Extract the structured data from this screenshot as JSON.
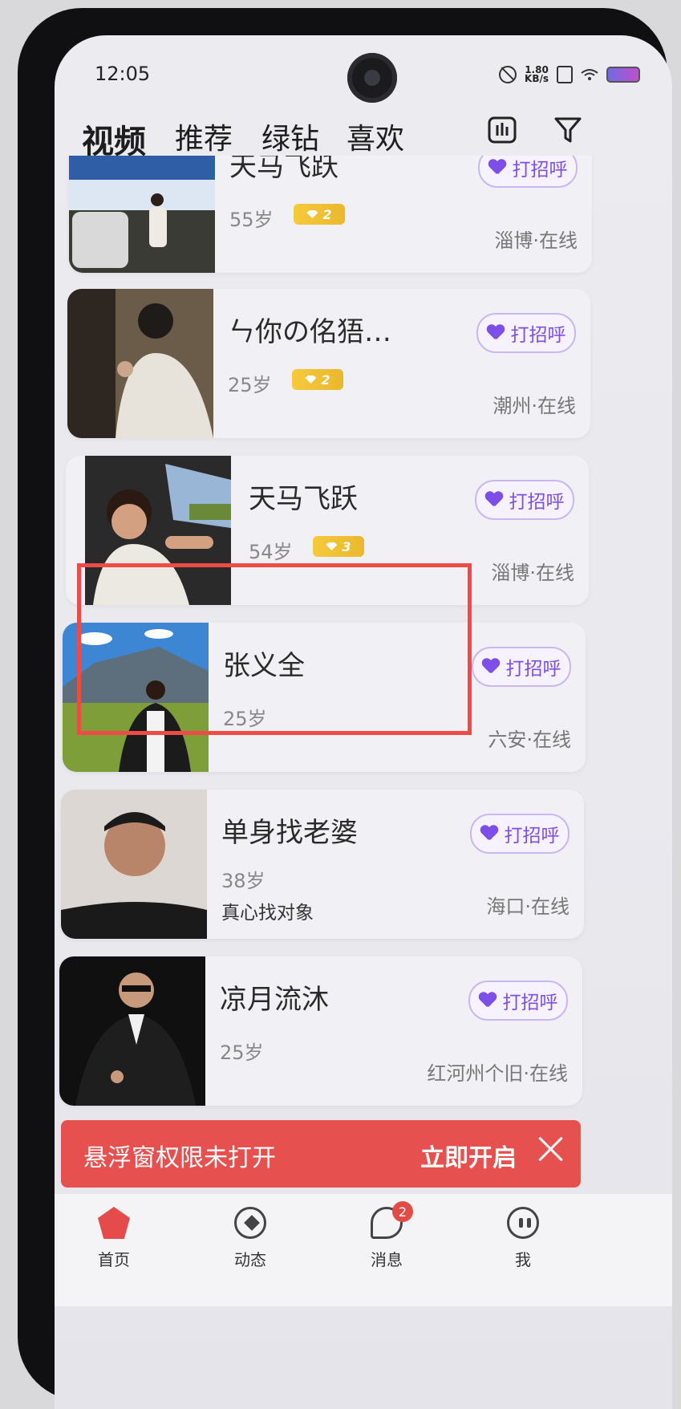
{
  "status_bar": {
    "time": "12:05",
    "speed_value": "1.80",
    "speed_unit": "KB/s"
  },
  "top_tabs": [
    "视频",
    "推荐",
    "绿钻",
    "喜欢"
  ],
  "cards": [
    {
      "name": "天马飞跃",
      "age": "55岁",
      "vip_level": "2",
      "bio": "",
      "location": "淄博·在线",
      "action": "打招呼"
    },
    {
      "name": "ㄣ你の佲㹳…",
      "age": "25岁",
      "vip_level": "2",
      "bio": "",
      "location": "潮州·在线",
      "action": "打招呼"
    },
    {
      "name": "天马飞跃",
      "age": "54岁",
      "vip_level": "3",
      "bio": "",
      "location": "淄博·在线",
      "action": "打招呼"
    },
    {
      "name": "张义全",
      "age": "25岁",
      "vip_level": "",
      "bio": "",
      "location": "六安·在线",
      "action": "打招呼"
    },
    {
      "name": "单身找老婆",
      "age": "38岁",
      "vip_level": "",
      "bio": "真心找对象",
      "location": "海口·在线",
      "action": "打招呼"
    },
    {
      "name": "凉月流沐",
      "age": "25岁",
      "vip_level": "",
      "bio": "",
      "location": "红河州个旧·在线",
      "action": "打招呼"
    }
  ],
  "banner": {
    "text": "悬浮窗权限未打开",
    "action": "立即开启"
  },
  "bottom_nav": [
    {
      "label": "首页"
    },
    {
      "label": "动态"
    },
    {
      "label": "消息",
      "badge": "2"
    },
    {
      "label": "我"
    }
  ],
  "colors": {
    "accent": "#7d4ee8",
    "banner": "#e6514f",
    "highlight": "#ee4a46",
    "vip": "#f6c93b"
  }
}
